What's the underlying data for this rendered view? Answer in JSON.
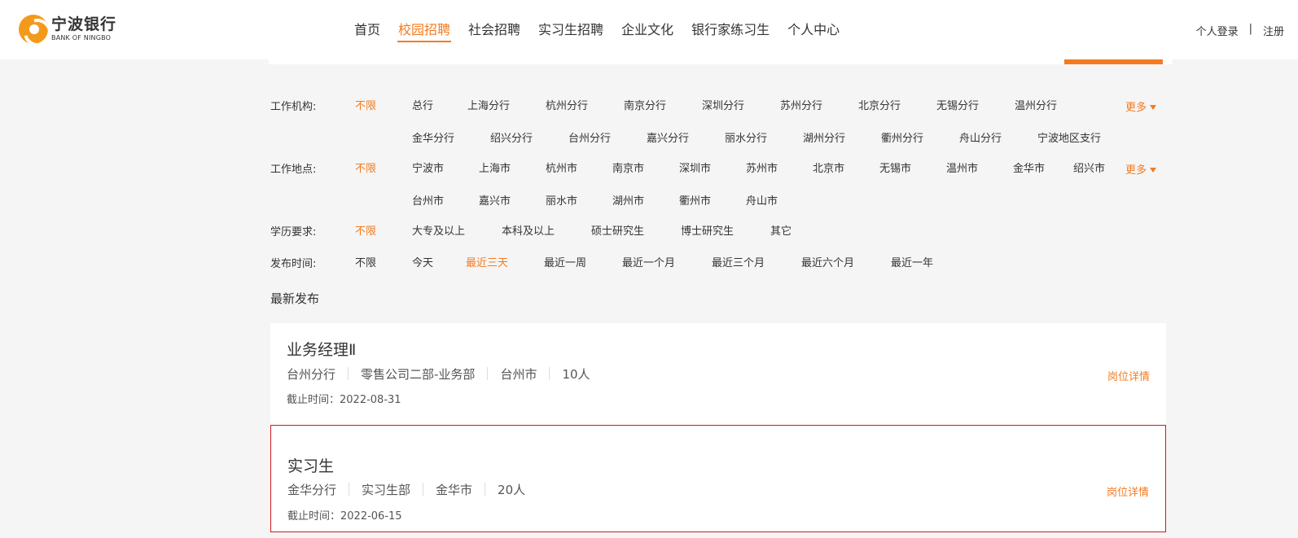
{
  "header": {
    "logo_cn": "宁波银行",
    "logo_en": "BANK OF NINGBO",
    "nav": [
      {
        "label": "首页"
      },
      {
        "label": "校园招聘"
      },
      {
        "label": "社会招聘"
      },
      {
        "label": "实习生招聘"
      },
      {
        "label": "企业文化"
      },
      {
        "label": "银行家练习生"
      },
      {
        "label": "个人中心"
      }
    ],
    "active_nav": "校园招聘",
    "login": "个人登录",
    "sep": "|",
    "register": "注册"
  },
  "filters": {
    "institution": {
      "label": "工作机构:",
      "any": "不限",
      "options_row1": [
        "总行",
        "上海分行",
        "杭州分行",
        "南京分行",
        "深圳分行",
        "苏州分行",
        "北京分行",
        "无锡分行",
        "温州分行"
      ],
      "options_row2": [
        "金华分行",
        "绍兴分行",
        "台州分行",
        "嘉兴分行",
        "丽水分行",
        "湖州分行",
        "衢州分行",
        "舟山分行",
        "宁波地区支行"
      ],
      "more": "更多"
    },
    "location": {
      "label": "工作地点:",
      "any": "不限",
      "options_row1": [
        "宁波市",
        "上海市",
        "杭州市",
        "南京市",
        "深圳市",
        "苏州市",
        "北京市",
        "无锡市",
        "温州市",
        "金华市",
        "绍兴市"
      ],
      "options_row2": [
        "台州市",
        "嘉兴市",
        "丽水市",
        "湖州市",
        "衢州市",
        "舟山市"
      ],
      "more": "更多"
    },
    "education": {
      "label": "学历要求:",
      "any": "不限",
      "options": [
        "大专及以上",
        "本科及以上",
        "硕士研究生",
        "博士研究生",
        "其它"
      ]
    },
    "publish_time": {
      "label": "发布时间:",
      "any": "不限",
      "options": [
        "今天",
        "最近三天",
        "最近一周",
        "最近一个月",
        "最近三个月",
        "最近六个月",
        "最近一年"
      ],
      "selected": "最近三天"
    }
  },
  "section_title": "最新发布",
  "jobs": [
    {
      "title": "业务经理Ⅱ",
      "branch": "台州分行",
      "department": "零售公司二部-业务部",
      "city": "台州市",
      "headcount": "10人",
      "deadline": "截止时间：2022-08-31",
      "detail": "岗位详情"
    },
    {
      "title": "实习生",
      "branch": "金华分行",
      "department": "实习生部",
      "city": "金华市",
      "headcount": "20人",
      "deadline": "截止时间：2022-06-15",
      "detail": "岗位详情"
    }
  ],
  "colors": {
    "accent": "#f37b21",
    "highlight_border": "#d9141c",
    "background": "#f5f5f5"
  }
}
